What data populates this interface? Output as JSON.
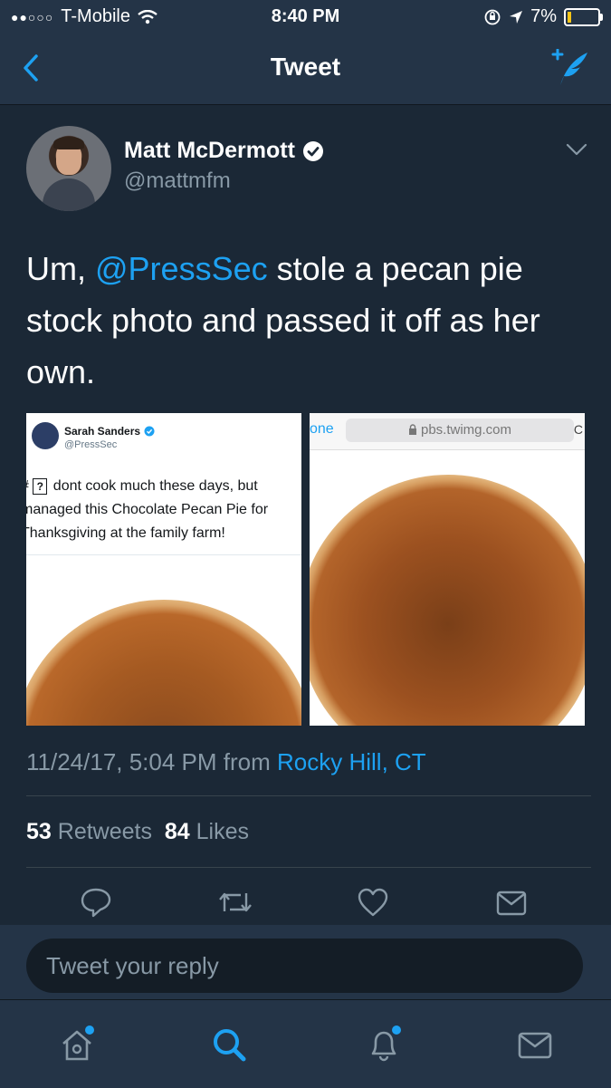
{
  "status_bar": {
    "signal": "●●○○○",
    "carrier": "T-Mobile",
    "time": "8:40 PM",
    "battery": "7%"
  },
  "nav": {
    "title": "Tweet"
  },
  "tweet": {
    "author_name": "Matt McDermott",
    "author_handle": "@mattmfm",
    "text_prefix": "Um, ",
    "mention": "@PressSec",
    "text_suffix": " stole a pecan pie stock photo and passed it off as her own.",
    "timestamp": "11/24/17, 5:04 PM from ",
    "location": "Rocky Hill, CT",
    "retweets": "53",
    "retweets_label": "Retweets",
    "likes": "84",
    "likes_label": "Likes"
  },
  "image1": {
    "name": "Sarah Sanders",
    "handle": "@PressSec",
    "prefix": "# ",
    "qmark": "?",
    "text": " dont cook much these days, but managed this Chocolate Pecan Pie for Thanksgiving at the family farm!"
  },
  "image2": {
    "done": "one",
    "url": "pbs.twimg.com",
    "reload": "C"
  },
  "reply": {
    "placeholder": "Tweet your reply"
  },
  "colors": {
    "background": "#1b2836",
    "bar": "#243447",
    "accent": "#1da1f2",
    "muted": "#8899a6"
  },
  "icons": {
    "actions": [
      "reply-icon",
      "retweet-icon",
      "like-icon",
      "dm-icon"
    ],
    "tabs": [
      "home-icon",
      "search-icon",
      "notifications-icon",
      "messages-icon"
    ]
  }
}
